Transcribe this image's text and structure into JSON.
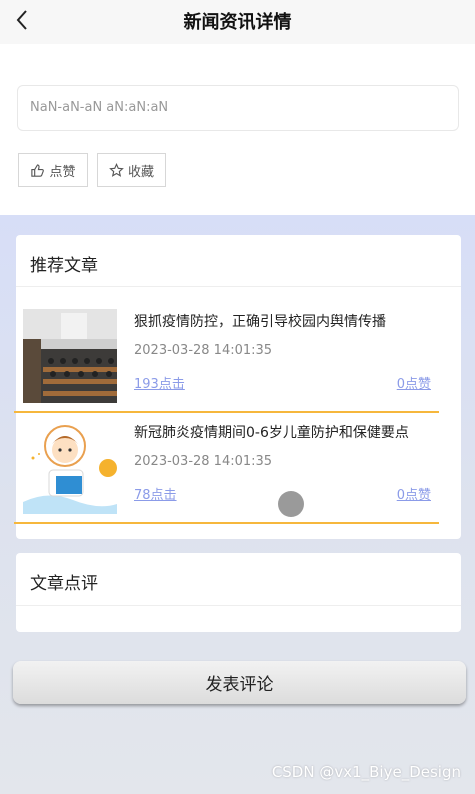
{
  "header": {
    "title": "新闻资讯详情",
    "back_icon": "chevron-left-icon"
  },
  "detail": {
    "date_text": "NaN-aN-aN aN:aN:aN",
    "like_label": "点赞",
    "like_icon": "thumbs-up-icon",
    "fav_label": "收藏",
    "fav_icon": "star-icon"
  },
  "recommend": {
    "title": "推荐文章",
    "articles": [
      {
        "title": "狠抓疫情防控，正确引导校园内舆情传播",
        "time": "2023-03-28 14:01:35",
        "clicks": "193点击",
        "likes": "0点赞"
      },
      {
        "title": "新冠肺炎疫情期间0-6岁儿童防护和保健要点",
        "time": "2023-03-28 14:01:35",
        "clicks": "78点击",
        "likes": "0点赞"
      }
    ]
  },
  "comments": {
    "title": "文章点评"
  },
  "actions": {
    "post_comment": "发表评论"
  },
  "watermark": "CSDN @vx1_Biye_Design",
  "colors": {
    "accent_orange": "#f6b73c",
    "link_blue": "#8b9be8",
    "bg_gradient_top": "#d7def7"
  }
}
